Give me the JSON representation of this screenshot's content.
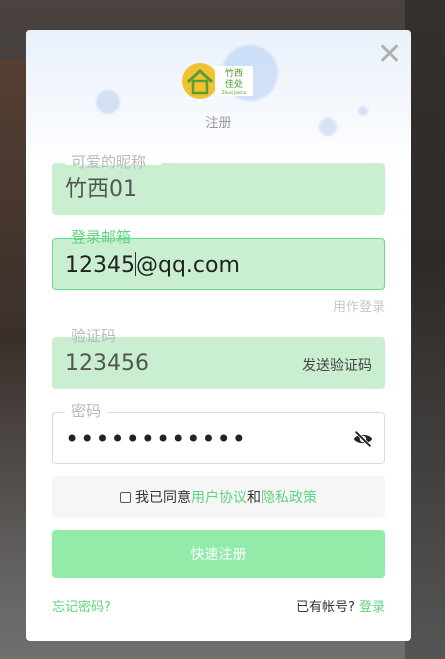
{
  "dialog": {
    "close_glyph": "✕",
    "subtitle": "注册",
    "logo": {
      "text_line1": "竹西",
      "text_line2": "佳处",
      "text_small": "Zhuxi Jiachu"
    }
  },
  "form": {
    "nickname": {
      "label": "可爱的昵称",
      "value": "竹西01"
    },
    "email": {
      "label": "登录邮箱",
      "value_before_caret": "12345",
      "value_after_caret": "@qq.com"
    },
    "email_hint": "用作登录",
    "code": {
      "label": "验证码",
      "value": "123456",
      "send_label": "发送验证码"
    },
    "password": {
      "label": "密码",
      "masked_value": "••••••••••••"
    },
    "agreement": {
      "prefix": "我已同意",
      "user_agreement": "用户协议",
      "and": "和",
      "privacy_policy": "隐私政策",
      "checked": false
    },
    "submit_label": "快速注册"
  },
  "footer": {
    "forgot": "忘记密码?",
    "have_account": "已有帐号?",
    "login": "登录"
  },
  "colors": {
    "accent": "#5fd47f",
    "field_fill": "#c9efd0",
    "button_fill": "#93ebaa"
  }
}
